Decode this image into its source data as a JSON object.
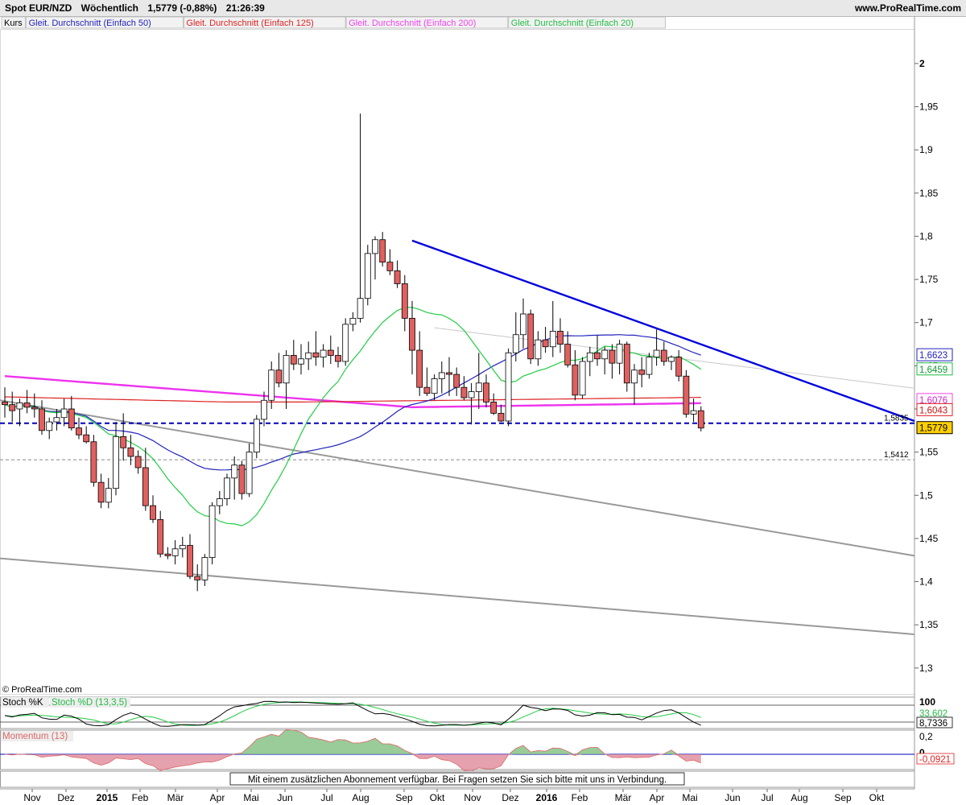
{
  "header": {
    "instrument": "Spot EUR/NZD",
    "period": "Wöchentlich",
    "last_price": "1,5779 (-0,88%)",
    "time": "21:26:39",
    "site": "www.ProRealTime.com"
  },
  "legend": [
    {
      "label": "Kurs",
      "color": "#000000"
    },
    {
      "label": "Gleit. Durchschnitt (Einfach 50)",
      "color": "#2222bb"
    },
    {
      "label": "Gleit. Durchschnitt (Einfach 125)",
      "color": "#dd2222"
    },
    {
      "label": "Gleit. Durchschnitt (Einfach 200)",
      "color": "#ee44ee"
    },
    {
      "label": "Gleit. Durchschnitt (Einfach 20)",
      "color": "#22bb44"
    }
  ],
  "copyright": "© ProRealTime.com",
  "notice": "Mit einem zusätzlichen Abonnement verfügbar. Bei Fragen setzen Sie sich bitte mit uns in Verbindung.",
  "price_axis": {
    "ticks": [
      "2",
      "1,95",
      "1,9",
      "1,85",
      "1,8",
      "1,75",
      "1,7",
      "1,65",
      "1,6",
      "1,55",
      "1,5",
      "1,45",
      "1,4",
      "1,35",
      "1,3"
    ],
    "tick_values": [
      2.0,
      1.95,
      1.9,
      1.85,
      1.8,
      1.75,
      1.7,
      1.65,
      1.6,
      1.55,
      1.5,
      1.45,
      1.4,
      1.35,
      1.3
    ],
    "range": [
      1.27,
      2.04
    ]
  },
  "price_labels": [
    {
      "text": "1,6623",
      "value": 1.6623,
      "border": "#2222bb",
      "bg": "#ffffff",
      "color": "#2222bb"
    },
    {
      "text": "1,6459",
      "value": 1.6459,
      "border": "#22bb44",
      "bg": "#ffffff",
      "color": "#119933"
    },
    {
      "text": "1,6076",
      "value": 1.6076,
      "border": "#ee44ee",
      "bg": "#ffffff",
      "color": "#cc22cc"
    },
    {
      "text": "1,6043",
      "value": 1.6043,
      "border": "#dd2222",
      "bg": "#ffffff",
      "color": "#cc1111"
    },
    {
      "text": "1,5779",
      "value": 1.5779,
      "border": "#000000",
      "bg": "#ffd000",
      "color": "#000000"
    }
  ],
  "level_labels": [
    {
      "text": "1,5835",
      "value": 1.5835,
      "style": "blue-dashed"
    },
    {
      "text": "1,5412",
      "value": 1.5412,
      "style": "grey-dashed"
    }
  ],
  "time_axis": {
    "labels": [
      "Nov",
      "Dez",
      "2015",
      "Feb",
      "Mär",
      "Apr",
      "Mai",
      "Jun",
      "Jul",
      "Aug",
      "Sep",
      "Okt",
      "Nov",
      "Dez",
      "2016",
      "Feb",
      "Mär",
      "Apr",
      "Mai",
      "Jun",
      "Jul",
      "Aug",
      "Sep",
      "Okt"
    ],
    "bold": [
      "2015",
      "2016"
    ]
  },
  "stoch_panel": {
    "title_k": "Stoch %K",
    "title_d": "Stoch %D (13,3,5)",
    "ticks": [
      "100"
    ],
    "value_d": "33,602",
    "value_k": "8,7336"
  },
  "momentum_panel": {
    "title": "Momentum (13)",
    "ticks": [
      "0,2",
      "0"
    ],
    "value": "-0,0921"
  },
  "chart_data": {
    "type": "candlestick",
    "title": "Spot EUR/NZD Wöchentlich",
    "frequency": "weekly",
    "x_range": [
      "2014-10",
      "2016-10"
    ],
    "candles": [
      {
        "o": 1.608,
        "h": 1.625,
        "l": 1.59,
        "c": 1.605
      },
      {
        "o": 1.605,
        "h": 1.62,
        "l": 1.585,
        "c": 1.598
      },
      {
        "o": 1.6,
        "h": 1.612,
        "l": 1.58,
        "c": 1.607
      },
      {
        "o": 1.607,
        "h": 1.622,
        "l": 1.595,
        "c": 1.602
      },
      {
        "o": 1.602,
        "h": 1.618,
        "l": 1.59,
        "c": 1.6
      },
      {
        "o": 1.6,
        "h": 1.61,
        "l": 1.57,
        "c": 1.575
      },
      {
        "o": 1.575,
        "h": 1.59,
        "l": 1.565,
        "c": 1.585
      },
      {
        "o": 1.585,
        "h": 1.6,
        "l": 1.575,
        "c": 1.59
      },
      {
        "o": 1.59,
        "h": 1.612,
        "l": 1.58,
        "c": 1.6
      },
      {
        "o": 1.6,
        "h": 1.615,
        "l": 1.575,
        "c": 1.578
      },
      {
        "o": 1.578,
        "h": 1.59,
        "l": 1.565,
        "c": 1.57
      },
      {
        "o": 1.57,
        "h": 1.58,
        "l": 1.56,
        "c": 1.562
      },
      {
        "o": 1.562,
        "h": 1.57,
        "l": 1.51,
        "c": 1.515
      },
      {
        "o": 1.515,
        "h": 1.525,
        "l": 1.485,
        "c": 1.492
      },
      {
        "o": 1.492,
        "h": 1.52,
        "l": 1.485,
        "c": 1.508
      },
      {
        "o": 1.508,
        "h": 1.585,
        "l": 1.5,
        "c": 1.568
      },
      {
        "o": 1.568,
        "h": 1.595,
        "l": 1.54,
        "c": 1.555
      },
      {
        "o": 1.555,
        "h": 1.57,
        "l": 1.535,
        "c": 1.545
      },
      {
        "o": 1.545,
        "h": 1.552,
        "l": 1.525,
        "c": 1.532
      },
      {
        "o": 1.532,
        "h": 1.555,
        "l": 1.482,
        "c": 1.488
      },
      {
        "o": 1.488,
        "h": 1.5,
        "l": 1.468,
        "c": 1.472
      },
      {
        "o": 1.472,
        "h": 1.482,
        "l": 1.428,
        "c": 1.432
      },
      {
        "o": 1.432,
        "h": 1.44,
        "l": 1.426,
        "c": 1.43
      },
      {
        "o": 1.43,
        "h": 1.448,
        "l": 1.42,
        "c": 1.438
      },
      {
        "o": 1.438,
        "h": 1.452,
        "l": 1.428,
        "c": 1.442
      },
      {
        "o": 1.442,
        "h": 1.455,
        "l": 1.403,
        "c": 1.406
      },
      {
        "o": 1.406,
        "h": 1.42,
        "l": 1.389,
        "c": 1.402
      },
      {
        "o": 1.402,
        "h": 1.432,
        "l": 1.395,
        "c": 1.428
      },
      {
        "o": 1.428,
        "h": 1.492,
        "l": 1.42,
        "c": 1.488
      },
      {
        "o": 1.488,
        "h": 1.505,
        "l": 1.478,
        "c": 1.496
      },
      {
        "o": 1.496,
        "h": 1.525,
        "l": 1.488,
        "c": 1.52
      },
      {
        "o": 1.52,
        "h": 1.545,
        "l": 1.495,
        "c": 1.535
      },
      {
        "o": 1.535,
        "h": 1.54,
        "l": 1.495,
        "c": 1.502
      },
      {
        "o": 1.502,
        "h": 1.56,
        "l": 1.498,
        "c": 1.55
      },
      {
        "o": 1.55,
        "h": 1.593,
        "l": 1.543,
        "c": 1.588
      },
      {
        "o": 1.588,
        "h": 1.62,
        "l": 1.58,
        "c": 1.61
      },
      {
        "o": 1.61,
        "h": 1.655,
        "l": 1.6,
        "c": 1.645
      },
      {
        "o": 1.645,
        "h": 1.665,
        "l": 1.625,
        "c": 1.63
      },
      {
        "o": 1.63,
        "h": 1.668,
        "l": 1.6,
        "c": 1.662
      },
      {
        "o": 1.662,
        "h": 1.68,
        "l": 1.645,
        "c": 1.652
      },
      {
        "o": 1.652,
        "h": 1.675,
        "l": 1.64,
        "c": 1.658
      },
      {
        "o": 1.658,
        "h": 1.678,
        "l": 1.645,
        "c": 1.665
      },
      {
        "o": 1.665,
        "h": 1.69,
        "l": 1.65,
        "c": 1.66
      },
      {
        "o": 1.66,
        "h": 1.675,
        "l": 1.648,
        "c": 1.668
      },
      {
        "o": 1.668,
        "h": 1.685,
        "l": 1.652,
        "c": 1.662
      },
      {
        "o": 1.662,
        "h": 1.672,
        "l": 1.648,
        "c": 1.655
      },
      {
        "o": 1.655,
        "h": 1.705,
        "l": 1.65,
        "c": 1.698
      },
      {
        "o": 1.698,
        "h": 1.712,
        "l": 1.69,
        "c": 1.705
      },
      {
        "o": 1.705,
        "h": 1.942,
        "l": 1.7,
        "c": 1.728
      },
      {
        "o": 1.728,
        "h": 1.79,
        "l": 1.72,
        "c": 1.78
      },
      {
        "o": 1.78,
        "h": 1.8,
        "l": 1.75,
        "c": 1.796
      },
      {
        "o": 1.796,
        "h": 1.805,
        "l": 1.765,
        "c": 1.77
      },
      {
        "o": 1.77,
        "h": 1.785,
        "l": 1.755,
        "c": 1.76
      },
      {
        "o": 1.76,
        "h": 1.772,
        "l": 1.74,
        "c": 1.745
      },
      {
        "o": 1.745,
        "h": 1.755,
        "l": 1.69,
        "c": 1.705
      },
      {
        "o": 1.705,
        "h": 1.725,
        "l": 1.64,
        "c": 1.668
      },
      {
        "o": 1.668,
        "h": 1.69,
        "l": 1.615,
        "c": 1.625
      },
      {
        "o": 1.625,
        "h": 1.648,
        "l": 1.615,
        "c": 1.618
      },
      {
        "o": 1.618,
        "h": 1.64,
        "l": 1.61,
        "c": 1.635
      },
      {
        "o": 1.635,
        "h": 1.655,
        "l": 1.618,
        "c": 1.642
      },
      {
        "o": 1.642,
        "h": 1.66,
        "l": 1.615,
        "c": 1.64
      },
      {
        "o": 1.64,
        "h": 1.648,
        "l": 1.615,
        "c": 1.625
      },
      {
        "o": 1.625,
        "h": 1.638,
        "l": 1.61,
        "c": 1.613
      },
      {
        "o": 1.613,
        "h": 1.63,
        "l": 1.582,
        "c": 1.62
      },
      {
        "o": 1.62,
        "h": 1.665,
        "l": 1.6,
        "c": 1.63
      },
      {
        "o": 1.63,
        "h": 1.64,
        "l": 1.602,
        "c": 1.608
      },
      {
        "o": 1.608,
        "h": 1.618,
        "l": 1.593,
        "c": 1.595
      },
      {
        "o": 1.595,
        "h": 1.605,
        "l": 1.585,
        "c": 1.586
      },
      {
        "o": 1.586,
        "h": 1.67,
        "l": 1.58,
        "c": 1.665
      },
      {
        "o": 1.665,
        "h": 1.712,
        "l": 1.655,
        "c": 1.686
      },
      {
        "o": 1.686,
        "h": 1.728,
        "l": 1.67,
        "c": 1.71
      },
      {
        "o": 1.71,
        "h": 1.715,
        "l": 1.652,
        "c": 1.658
      },
      {
        "o": 1.658,
        "h": 1.69,
        "l": 1.65,
        "c": 1.68
      },
      {
        "o": 1.68,
        "h": 1.695,
        "l": 1.665,
        "c": 1.672
      },
      {
        "o": 1.672,
        "h": 1.725,
        "l": 1.66,
        "c": 1.69
      },
      {
        "o": 1.69,
        "h": 1.705,
        "l": 1.665,
        "c": 1.675
      },
      {
        "o": 1.675,
        "h": 1.69,
        "l": 1.648,
        "c": 1.651
      },
      {
        "o": 1.651,
        "h": 1.668,
        "l": 1.61,
        "c": 1.616
      },
      {
        "o": 1.616,
        "h": 1.66,
        "l": 1.612,
        "c": 1.655
      },
      {
        "o": 1.655,
        "h": 1.672,
        "l": 1.638,
        "c": 1.665
      },
      {
        "o": 1.665,
        "h": 1.685,
        "l": 1.65,
        "c": 1.658
      },
      {
        "o": 1.658,
        "h": 1.672,
        "l": 1.64,
        "c": 1.668
      },
      {
        "o": 1.668,
        "h": 1.675,
        "l": 1.635,
        "c": 1.653
      },
      {
        "o": 1.653,
        "h": 1.68,
        "l": 1.64,
        "c": 1.675
      },
      {
        "o": 1.675,
        "h": 1.678,
        "l": 1.62,
        "c": 1.63
      },
      {
        "o": 1.63,
        "h": 1.652,
        "l": 1.605,
        "c": 1.645
      },
      {
        "o": 1.645,
        "h": 1.66,
        "l": 1.625,
        "c": 1.64
      },
      {
        "o": 1.64,
        "h": 1.665,
        "l": 1.635,
        "c": 1.66
      },
      {
        "o": 1.66,
        "h": 1.692,
        "l": 1.65,
        "c": 1.668
      },
      {
        "o": 1.668,
        "h": 1.678,
        "l": 1.65,
        "c": 1.655
      },
      {
        "o": 1.655,
        "h": 1.662,
        "l": 1.645,
        "c": 1.66
      },
      {
        "o": 1.66,
        "h": 1.668,
        "l": 1.632,
        "c": 1.638
      },
      {
        "o": 1.638,
        "h": 1.645,
        "l": 1.59,
        "c": 1.594
      },
      {
        "o": 1.594,
        "h": 1.612,
        "l": 1.585,
        "c": 1.598
      },
      {
        "o": 1.598,
        "h": 1.603,
        "l": 1.574,
        "c": 1.5779
      }
    ],
    "sma20_end": 1.6459,
    "sma50_end": 1.6623,
    "sma125_end": 1.6043,
    "sma200_end": 1.6076,
    "horizontal_levels": [
      1.5835,
      1.5412
    ]
  }
}
